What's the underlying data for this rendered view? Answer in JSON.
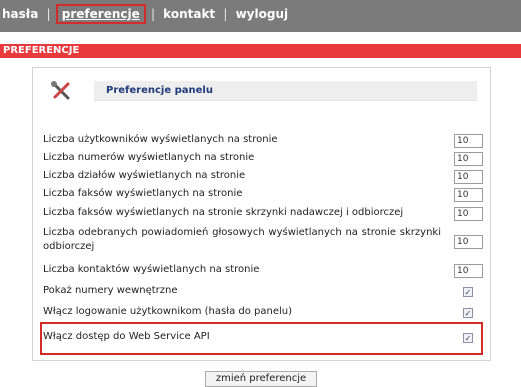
{
  "nav": {
    "item_passwords": "hasła",
    "sep": "|",
    "item_preferences": "preferencje",
    "item_contact": "kontakt",
    "item_logout": "wyloguj"
  },
  "section": {
    "title": "PREFERENCJE"
  },
  "panel": {
    "header": "Preferencje panelu"
  },
  "rows": [
    {
      "label": "Liczba użytkowników wyświetlanych na stronie",
      "value": "10"
    },
    {
      "label": "Liczba numerów wyświetlanych na stronie",
      "value": "10"
    },
    {
      "label": "Liczba działów wyświetlanych na stronie",
      "value": "10"
    },
    {
      "label": "Liczba faksów wyświetlanych na stronie",
      "value": "10"
    },
    {
      "label": "Liczba faksów wyświetlanych na stronie skrzynki nadawczej i odbiorczej",
      "value": "10"
    },
    {
      "label": "Liczba odebranych powiadomień głosowych wyświetlanych na stronie skrzynki odbiorczej",
      "value": "10"
    },
    {
      "label": "Liczba kontaktów wyświetlanych na stronie",
      "value": "10"
    }
  ],
  "checks": [
    {
      "label": "Pokaż numery wewnętrzne",
      "checked": true
    },
    {
      "label": "Włącz logowanie użytkownikom (hasła do panelu)",
      "checked": true
    },
    {
      "label": "Włącz dostęp do Web Service API",
      "checked": true
    }
  ],
  "check_mark": "✓",
  "submit_label": "zmień preferencje",
  "colors": {
    "nav_bg": "#7b7b7b",
    "section_bg": "#e8393c",
    "highlight": "#d52a2a",
    "header_text": "#1f3a7a"
  }
}
